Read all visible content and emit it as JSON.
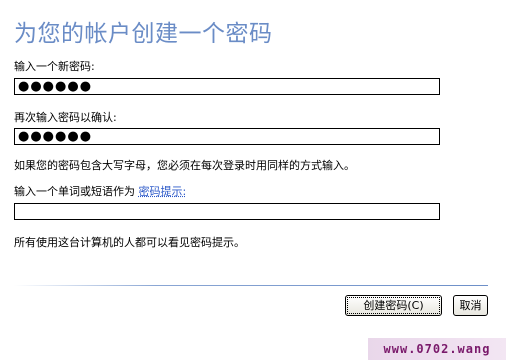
{
  "page": {
    "title": "为您的帐户创建一个密码",
    "new_password_label": "输入一个新密码:",
    "new_password_value": "●●●●●●",
    "confirm_password_label": "再次输入密码以确认:",
    "confirm_password_value": "●●●●●●",
    "case_note": "如果您的密码包含大写字母，您必须在每次登录时用同样的方式输入。",
    "hint_label_prefix": "输入一个单词或短语作为",
    "hint_link": "密码提示:",
    "hint_value": "",
    "hint_note": "所有使用这台计算机的人都可以看见密码提示。"
  },
  "buttons": {
    "create": "创建密码(C)",
    "cancel": "取消"
  },
  "watermark": "www.0702.wang"
}
